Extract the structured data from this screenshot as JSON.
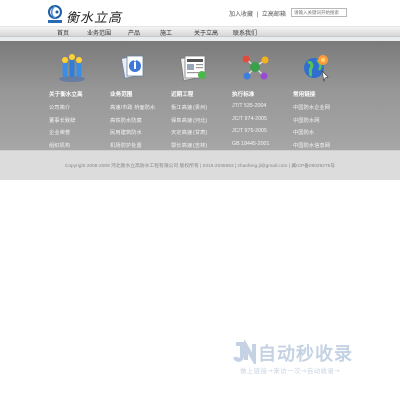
{
  "header": {
    "logo_text": "衡水立高",
    "top_links": [
      "加入收藏",
      "|",
      "立高邮箱"
    ],
    "search_placeholder": "请输入关键词开始搜索"
  },
  "nav": {
    "items": [
      "首页",
      "业务范围",
      "产品",
      "施工",
      "关于立高",
      "联系我们"
    ]
  },
  "broken_image_alt": "",
  "columns": [
    {
      "title": "关于衡水立高",
      "icon": "people-icon",
      "links": [
        "公司简介",
        "董事长致辞",
        "企业荣誉",
        "组织机构"
      ]
    },
    {
      "title": "业务范围",
      "icon": "documents-icon",
      "links": [
        "高速/市政 桥面防水",
        "高铁防水防腐",
        "民用建筑防水",
        "机场防护处置"
      ]
    },
    {
      "title": "近期工程",
      "icon": "newspaper-icon",
      "rows": [
        [
          "板江高速",
          "(贵州)"
        ],
        [
          "保阜高速",
          "(河北)"
        ],
        [
          "天定高速",
          "(甘肃)"
        ],
        [
          "鄂长高速",
          "(吉林)"
        ]
      ]
    },
    {
      "title": "执行标准",
      "icon": "network-icon",
      "links": [
        "JT/T 535-2004",
        "JC/T 974-2005",
        "JC/T 975-2005",
        "GB 18445-2001"
      ]
    },
    {
      "title": "常用链接",
      "icon": "globe-icon",
      "links": [
        "中国防水企业网",
        "中国防水网",
        "中国防水",
        "中国防水信息网"
      ]
    }
  ],
  "footer": {
    "copyright": "Copyright 2008-2009 河北衡水立高防水工程有限公司 版权所有 | 0318-2036693 | zhanfeng.jl@gmail.com | 冀ICP备09029275号"
  },
  "watermark": {
    "title": "自动秒收录",
    "subtitle": "做上链接→来访一次→自动收录→"
  },
  "colors": {
    "main_bg": "#979797",
    "footer_bg": "#dcdcdc",
    "nav_bg": "#e4e4e4"
  }
}
